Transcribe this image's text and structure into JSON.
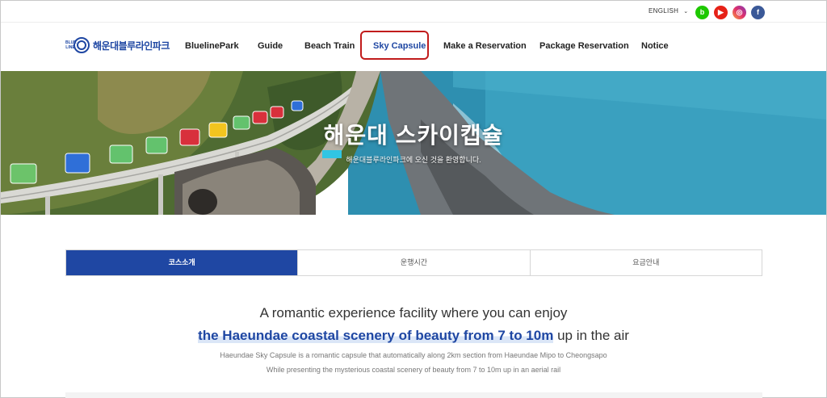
{
  "topbar": {
    "language": "ENGLISH",
    "social": [
      {
        "name": "blog-icon",
        "glyph": "b",
        "color": "#1ec800"
      },
      {
        "name": "youtube-icon",
        "glyph": "▶",
        "color": "#e62117"
      },
      {
        "name": "instagram-icon",
        "glyph": "◎",
        "color": "#e1306c"
      },
      {
        "name": "facebook-icon",
        "glyph": "f",
        "color": "#3b5998"
      }
    ]
  },
  "logo": {
    "text": "해운대블루라인파크",
    "mark_tag": "BLUE LINE"
  },
  "nav": {
    "items": [
      {
        "label": "BluelinePark"
      },
      {
        "label": "Guide"
      },
      {
        "label": "Beach Train"
      },
      {
        "label": "Sky Capsule"
      },
      {
        "label": "Make a Reservation"
      },
      {
        "label": "Package Reservation"
      },
      {
        "label": "Notice"
      }
    ],
    "active_index": 3
  },
  "hero": {
    "title": "해운대 스카이캡슐",
    "subtitle": "해운대블루라인파크에 오신 것을 환영합니다."
  },
  "tabs": [
    {
      "label": "코스소개",
      "active": true
    },
    {
      "label": "운행시간",
      "active": false
    },
    {
      "label": "요금안내",
      "active": false
    }
  ],
  "content": {
    "line1": "A romantic experience facility where you can enjoy",
    "line2_highlight": "the Haeundae coastal scenery of beauty from 7 to 10m",
    "line2_rest": " up in the air",
    "desc1": "Haeundae Sky Capsule is a romantic capsule that automatically along 2km section from Haeundae Mipo to Cheongsapo",
    "desc2": "While presenting the mysterious coastal scenery of beauty from 7 to 10m up in an aerial rail"
  },
  "colors": {
    "brand_blue": "#1f47a3",
    "highlight_red": "#c11c1c",
    "sea": "#2e8fb0"
  }
}
